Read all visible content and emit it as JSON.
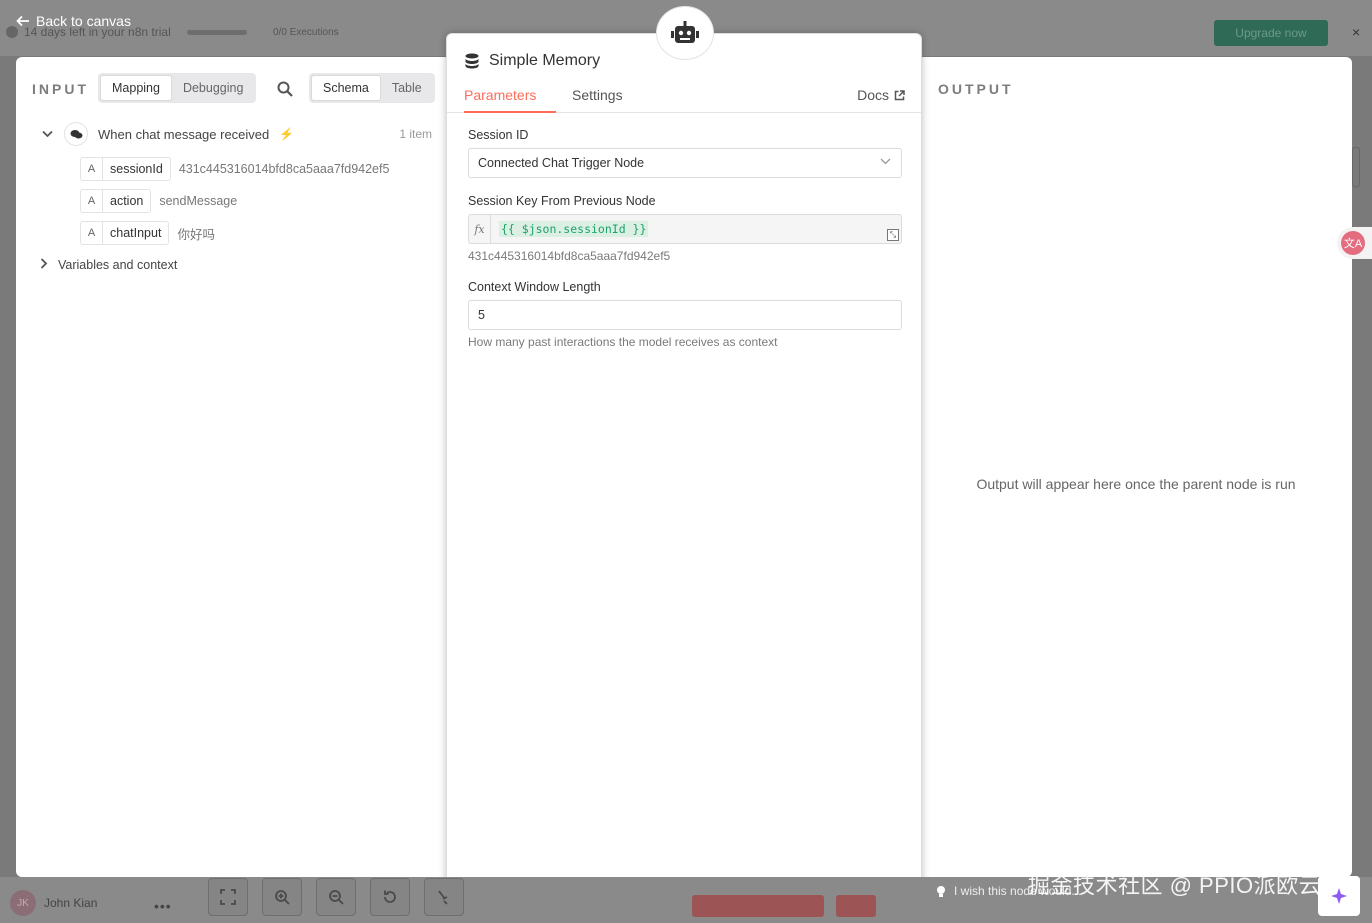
{
  "background": {
    "trial_text": "14 days left in your n8n trial",
    "executions": "0/0 Executions",
    "upgrade_label": "Upgrade now",
    "close_glyph": "×",
    "user_initials": "JK",
    "user_name": "John Kian",
    "more_glyph": "•••",
    "wish_text": "I wish this node would...",
    "watermark": "掘金技术社区 @ PPIO派欧云",
    "translate_glyph": "文A"
  },
  "header": {
    "back_label": "Back to canvas"
  },
  "input_panel": {
    "heading": "INPUT",
    "mode_tabs": [
      "Mapping",
      "Debugging"
    ],
    "view_tabs": [
      "Schema",
      "Table"
    ],
    "trigger": {
      "label": "When chat message received",
      "count": "1 item"
    },
    "fields": [
      {
        "type": "A",
        "name": "sessionId",
        "value": "431c445316014bfd8ca5aaa7fd942ef5"
      },
      {
        "type": "A",
        "name": "action",
        "value": "sendMessage"
      },
      {
        "type": "A",
        "name": "chatInput",
        "value": "你好吗"
      }
    ],
    "variables_label": "Variables and context"
  },
  "node": {
    "title": "Simple Memory",
    "tabs": [
      "Parameters",
      "Settings"
    ],
    "docs_label": "Docs",
    "session_id_label": "Session ID",
    "session_id_value": "Connected Chat Trigger Node",
    "session_key_label": "Session Key From Previous Node",
    "expr_fx": "fx",
    "session_key_expr": "{{ $json.sessionId }}",
    "session_key_result": "431c445316014bfd8ca5aaa7fd942ef5",
    "context_label": "Context Window Length",
    "context_value": "5",
    "context_hint": "How many past interactions the model receives as context"
  },
  "output_panel": {
    "heading": "OUTPUT",
    "message": "Output will appear here once the parent node is run"
  },
  "colors": {
    "accent": "#ff6d5a",
    "expression_green": "#1aa36a"
  }
}
